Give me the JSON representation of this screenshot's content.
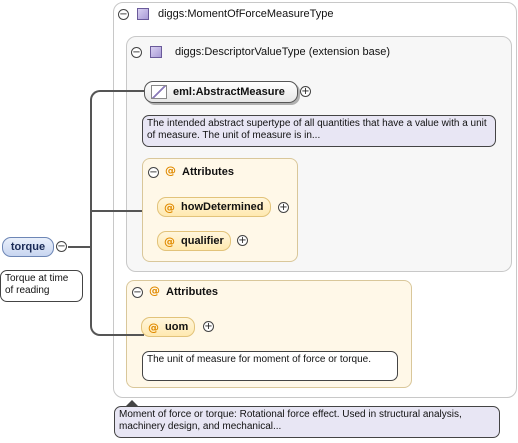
{
  "root": {
    "type_label": "diggs:MomentOfForceMeasureType",
    "description": "Moment of force or torque: Rotational force effect. Used in structural analysis, machinery design, and mechanical..."
  },
  "extension": {
    "label": "diggs:DescriptorValueType (extension base)",
    "element": {
      "label": "eml:AbstractMeasure",
      "description": "The intended abstract supertype of all quantities that have a value with a unit of measure. The unit of measure is in..."
    },
    "attributes": {
      "title": "Attributes",
      "at_symbol": "@",
      "items": [
        {
          "label": "howDetermined"
        },
        {
          "label": "qualifier"
        }
      ]
    }
  },
  "own_attributes": {
    "title": "Attributes",
    "at_symbol": "@",
    "items": [
      {
        "label": "uom",
        "description": "The unit of measure for moment of force or torque."
      }
    ]
  },
  "torque": {
    "label": "torque",
    "description": "Torque at time of reading"
  },
  "glyphs": {
    "collapse": "⊖",
    "expand": "⊕",
    "minus": "−",
    "plus": "+"
  }
}
